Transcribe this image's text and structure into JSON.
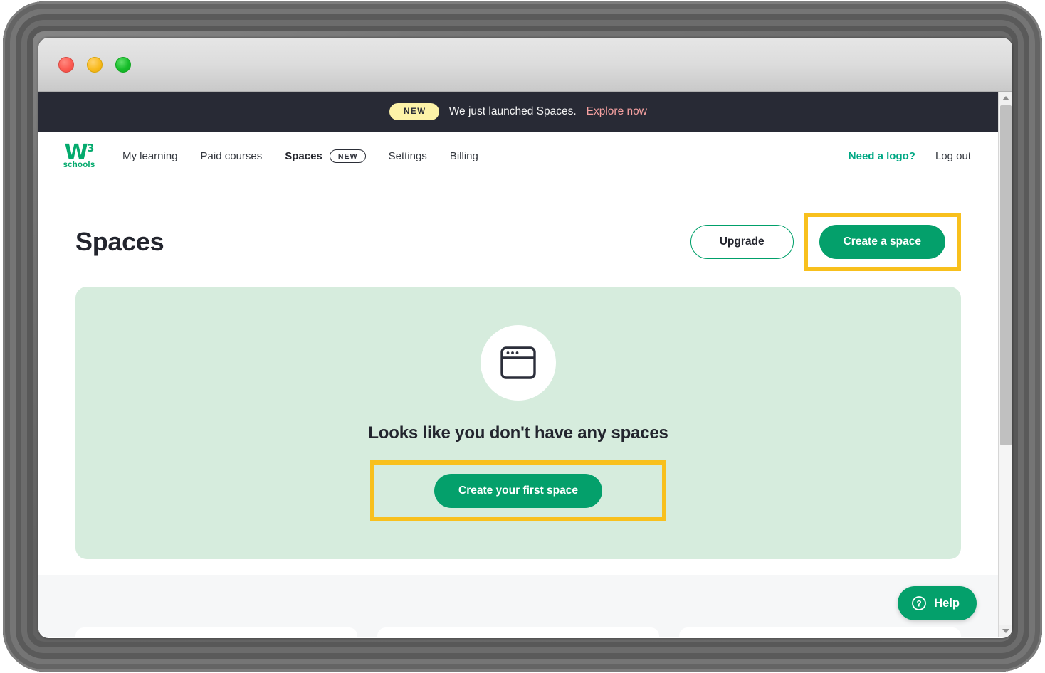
{
  "window": {
    "traffic_lights": [
      {
        "name": "close",
        "color": "#fc5b52"
      },
      {
        "name": "minimize",
        "color": "#f9bb20"
      },
      {
        "name": "maximize",
        "color": "#17bd2b"
      }
    ]
  },
  "promo_banner": {
    "badge": "NEW",
    "text": "We just launched Spaces.",
    "link_label": "Explore now",
    "background": "#282a35",
    "badge_background": "#fdf3a8",
    "link_color": "#f5a0a0"
  },
  "navbar": {
    "logo": {
      "mark": "W",
      "superscript": "3",
      "wordmark": "schools",
      "color": "#04AA6D"
    },
    "links": [
      {
        "label": "My learning",
        "active": false,
        "badge": null
      },
      {
        "label": "Paid courses",
        "active": false,
        "badge": null
      },
      {
        "label": "Spaces",
        "active": true,
        "badge": "NEW"
      },
      {
        "label": "Settings",
        "active": false,
        "badge": null
      },
      {
        "label": "Billing",
        "active": false,
        "badge": null
      }
    ],
    "need_logo_label": "Need a logo?",
    "need_logo_color": "#00a884",
    "logout_label": "Log out"
  },
  "main": {
    "title": "Spaces",
    "upgrade_label": "Upgrade",
    "create_space_label": "Create a space",
    "empty_state": {
      "icon": "browser-window-icon",
      "title": "Looks like you don't have any spaces",
      "cta_label": "Create your first space",
      "background": "#d6ecdd"
    }
  },
  "annotations": {
    "color": "#f8c01d",
    "highlighted": [
      "create-a-space-button",
      "create-your-first-space-button"
    ]
  },
  "help_widget": {
    "label": "Help",
    "icon": "question-circle-icon",
    "background": "#04a06b"
  },
  "theme": {
    "primary_green": "#04a06b",
    "dark_navy": "#282a35",
    "page_background": "#ffffff",
    "lower_background": "#f6f7f8"
  },
  "scrollbar": {
    "up_arrow": "scroll-up-arrow",
    "down_arrow": "scroll-down-arrow"
  }
}
